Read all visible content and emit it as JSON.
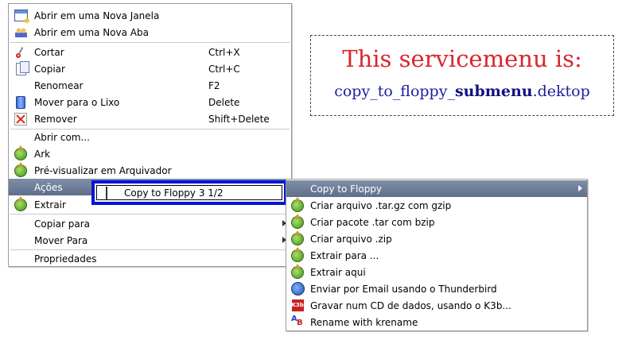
{
  "main_menu": {
    "items": [
      {
        "label": "Abrir em uma Nova Janela",
        "shortcut": "",
        "icon": "new-window-icon"
      },
      {
        "label": "Abrir em uma Nova Aba",
        "shortcut": "",
        "icon": "new-tab-icon"
      },
      {
        "label": "Cortar",
        "shortcut": "Ctrl+X",
        "icon": "cut-icon"
      },
      {
        "label": "Copiar",
        "shortcut": "Ctrl+C",
        "icon": "copy-icon"
      },
      {
        "label": "Renomear",
        "shortcut": "F2",
        "icon": ""
      },
      {
        "label": "Mover para o Lixo",
        "shortcut": "Delete",
        "icon": "trash-icon"
      },
      {
        "label": "Remover",
        "shortcut": "Shift+Delete",
        "icon": "remove-icon"
      },
      {
        "label": "Abrir com...",
        "shortcut": "",
        "icon": ""
      },
      {
        "label": "Ark",
        "shortcut": "",
        "icon": "ark-icon"
      },
      {
        "label": "Pré-visualizar em Arquivador",
        "shortcut": "",
        "icon": "ark-icon"
      },
      {
        "label": "Ações",
        "shortcut": "",
        "icon": ""
      },
      {
        "label": "Extrair",
        "shortcut": "",
        "icon": "ark-icon"
      },
      {
        "label": "Copiar para",
        "shortcut": "",
        "icon": ""
      },
      {
        "label": "Mover Para",
        "shortcut": "",
        "icon": ""
      },
      {
        "label": "Propriedades",
        "shortcut": "",
        "icon": ""
      }
    ]
  },
  "actions_popup": {
    "label": "Copy to Floppy 3 1/2",
    "icon": "floppy-icon"
  },
  "sub_menu": {
    "items": [
      {
        "label": "Copy to Floppy",
        "icon": ""
      },
      {
        "label": "Criar arquivo .tar.gz com gzip",
        "icon": "ark-icon"
      },
      {
        "label": "Criar pacote .tar com bzip",
        "icon": "ark-icon"
      },
      {
        "label": "Criar arquivo .zip",
        "icon": "ark-icon"
      },
      {
        "label": "Extrair para ...",
        "icon": "ark-icon"
      },
      {
        "label": "Extrair aqui",
        "icon": "ark-icon"
      },
      {
        "label": "Enviar por Email usando o Thunderbird",
        "icon": "thunderbird-icon"
      },
      {
        "label": "Gravar num CD de dados, usando o K3b...",
        "icon": "k3b-icon"
      },
      {
        "label": "Rename with krename",
        "icon": "krename-icon"
      }
    ]
  },
  "callout": {
    "line1": "This servicemenu is:",
    "line2_prefix": "copy_to_floppy_",
    "line2_bold": "submenu",
    "line2_suffix": ".dektop"
  },
  "colors": {
    "highlight": "#6b7b98",
    "popup_border": "#0014d8",
    "callout_red": "#d8262e",
    "callout_blue": "#1c1ca6"
  }
}
